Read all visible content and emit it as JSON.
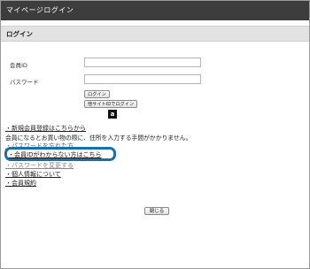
{
  "window": {
    "title": "マイページログイン"
  },
  "login": {
    "header": "ログイン",
    "member_id_label": "会員ID",
    "member_id_value": "",
    "password_label": "パスワード",
    "password_value": "",
    "login_button": "ログイン",
    "other_site_button": "他サイトIDでログイン",
    "amazon_icon_glyph": "a"
  },
  "links": {
    "new_registration": "・新規会員登録はこちらから",
    "registration_note": "会員になるとお買い物の際に、住所を入力する手間がかかりません。",
    "forgot_password": "・パスワードを忘れた方",
    "forgot_member_id": "・会員IDがわからない方はこちら",
    "password_change": "・パスワードを変更する",
    "personal_info": "・個人情報について",
    "terms": "・会員規約"
  },
  "footer": {
    "close_button": "閉じる"
  },
  "colors": {
    "titlebar": "#3d3d3d",
    "highlight": "#1a6fa6"
  }
}
